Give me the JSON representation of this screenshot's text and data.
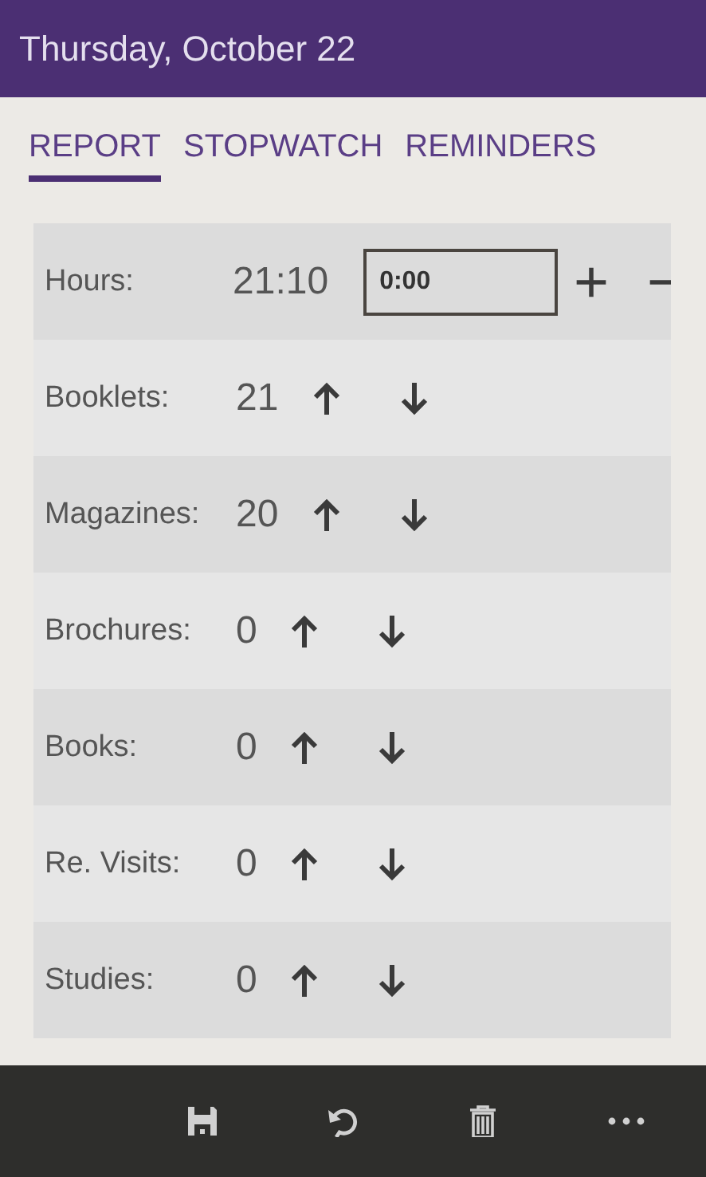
{
  "header": {
    "title": "Thursday, October  22"
  },
  "tabs": [
    {
      "label": "REPORT",
      "selected": true
    },
    {
      "label": "STOPWATCH",
      "selected": false
    },
    {
      "label": "REMINDERS",
      "selected": false
    }
  ],
  "rows": [
    {
      "kind": "time",
      "label": "Hours:",
      "value": "21:10",
      "input": "0:00"
    },
    {
      "kind": "counter",
      "label": "Booklets:",
      "value": "21"
    },
    {
      "kind": "counter",
      "label": "Magazines:",
      "value": "20"
    },
    {
      "kind": "counter",
      "label": "Brochures:",
      "value": "0"
    },
    {
      "kind": "counter",
      "label": "Books:",
      "value": "0"
    },
    {
      "kind": "counter",
      "label": "Re. Visits:",
      "value": "0"
    },
    {
      "kind": "counter",
      "label": "Studies:",
      "value": "0"
    }
  ],
  "app_bar": {
    "buttons": [
      {
        "kind": "save"
      },
      {
        "kind": "undo"
      },
      {
        "kind": "delete"
      },
      {
        "kind": "more"
      }
    ]
  }
}
